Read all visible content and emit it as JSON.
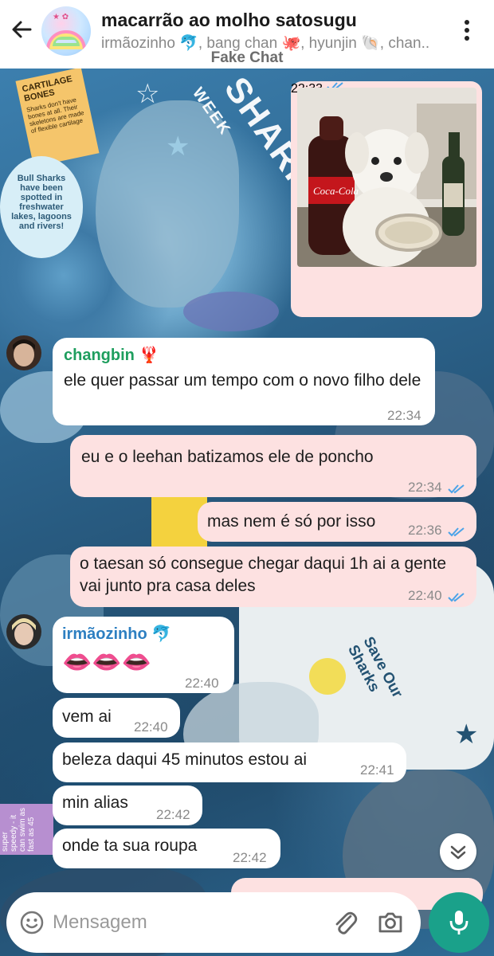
{
  "header": {
    "title": "macarrão ao molho satosugu",
    "subtitle": "irmãozinho 🐬, bang chan 🐙, hyunjin 🐚, chan..",
    "watermark": "Fake Chat"
  },
  "wallpaper": {
    "cartilage_title": "CARTILAGE BONES",
    "cartilage_body": "Sharks don't have bones at all. Their skeletons are made of flexible cartilage",
    "bull_sharks": "Bull Sharks have been spotted in freshwater lakes, lagoons and rivers!",
    "week": "WEEK",
    "shark_word": "SHARK",
    "save_our_sharks": "Save Our Sharks",
    "speedy": "super speedy - it can swim as fast as 45"
  },
  "messages": [
    {
      "time": "22:33"
    },
    {
      "sender": "changbin",
      "sender_emoji": "🦞",
      "text": "ele quer passar um tempo com o novo filho dele",
      "time": "22:34"
    },
    {
      "text": "eu e o leehan batizamos ele de poncho",
      "time": "22:34"
    },
    {
      "text": "mas nem é só por isso",
      "time": "22:36"
    },
    {
      "text": "o taesan só consegue chegar daqui 1h ai a gente vai junto pra casa deles",
      "time": "22:40"
    },
    {
      "sender": "irmãozinho",
      "sender_emoji": "🐬",
      "text": "👄👄👄",
      "time": "22:40"
    },
    {
      "text": "vem ai",
      "time": "22:40"
    },
    {
      "text": "beleza daqui 45 minutos estou ai",
      "time": "22:41"
    },
    {
      "text": "min alias",
      "time": "22:42"
    },
    {
      "text": "onde ta sua roupa",
      "time": "22:42"
    }
  ],
  "composer": {
    "placeholder": "Mensagem"
  },
  "colors": {
    "outgoing_bubble": "#fde1e1",
    "incoming_bubble": "#ffffff",
    "changbin_name": "#1e9e5e",
    "irmaozinho_name": "#2d7fc1",
    "read_ticks": "#4aa3e8",
    "mic_button": "#1aa18a"
  }
}
